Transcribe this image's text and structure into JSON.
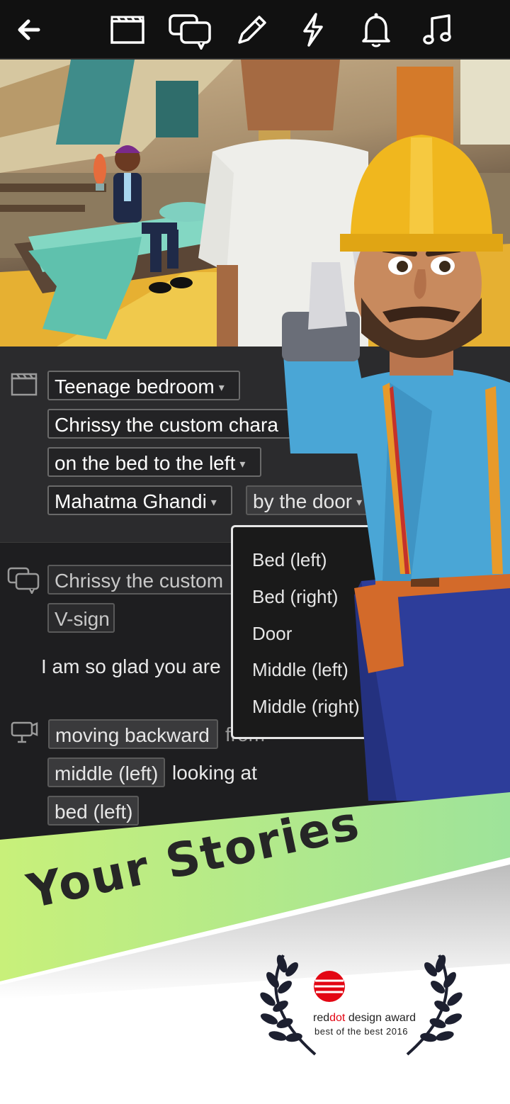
{
  "toolbar": {
    "icons": [
      "back-arrow-icon",
      "clapperboard-icon",
      "speech-bubbles-icon",
      "pencil-icon",
      "lightning-icon",
      "bell-icon",
      "music-note-icon"
    ]
  },
  "scene_section": {
    "location": "Teenage bedroom",
    "character": "Chrissy the custom chara",
    "character_position": "on the bed to the left",
    "second_character": "Mahatma Ghandi",
    "second_character_position": "by the door",
    "dropdown_arrow": "▾"
  },
  "dialogue_section": {
    "speaker": "Chrissy the custom",
    "gesture": "V-sign",
    "line": "I am so glad you are"
  },
  "camera_section": {
    "movement": "moving backward",
    "from_word": "from",
    "from_position": "middle (left)",
    "looking_at_text": "looking at",
    "target": "bed (left)"
  },
  "dropdown": {
    "options": [
      "Bed (left)",
      "Bed (right)",
      "Door",
      "Middle (left)",
      "Middle (right)"
    ]
  },
  "banner": {
    "title": "Your Stories"
  },
  "award": {
    "brand_red": "red",
    "brand_dot": "dot",
    "brand_rest": " design award",
    "subtitle": "best of the best 2016"
  },
  "colors": {
    "banner_green": "#a8e68c",
    "reddot_red": "#e30613",
    "panel_dark": "#2b2b2d"
  }
}
